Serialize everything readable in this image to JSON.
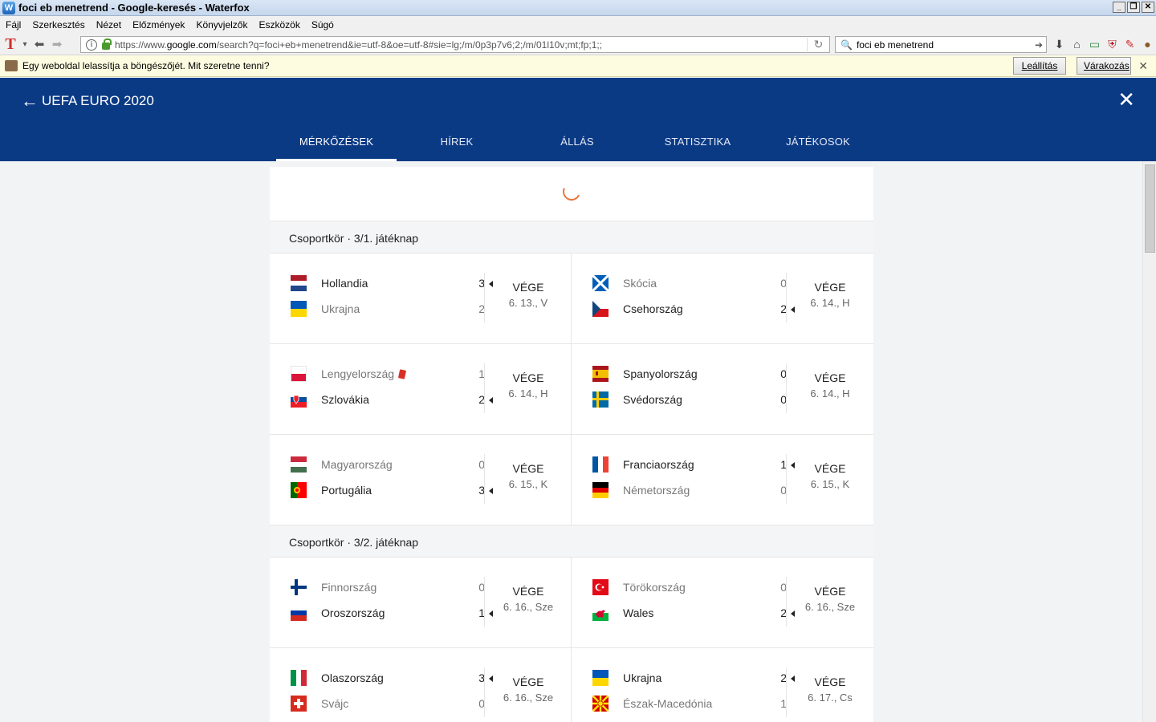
{
  "window": {
    "title": "foci eb menetrend - Google-keresés - Waterfox",
    "icon": "waterfox-icon"
  },
  "menu": [
    "Fájl",
    "Szerkesztés",
    "Nézet",
    "Előzmények",
    "Könyvjelzők",
    "Eszközök",
    "Súgó"
  ],
  "navbar": {
    "url_prefix": "https://www.",
    "url_domain": "google.com",
    "url_rest": "/search?q=foci+eb+menetrend&ie=utf-8&oe=utf-8#sie=lg;/m/0p3p7v6;2;/m/01l10v;mt;fp;1;;",
    "search_value": "foci eb menetrend"
  },
  "notification": {
    "text": "Egy weboldal lelassítja a böngészőjét. Mit szeretne tenni?",
    "stop_label": "Leállítás",
    "wait_label": "Várakozás"
  },
  "header": {
    "title": "UEFA EURO 2020",
    "tabs": [
      "MÉRKŐZÉSEK",
      "HÍREK",
      "ÁLLÁS",
      "STATISZTIKA",
      "JÁTÉKOSOK"
    ],
    "active_tab": 0
  },
  "groups": [
    {
      "title": "Csoportkör · 3/1. játéknap",
      "rows": [
        [
          {
            "teams": [
              {
                "name": "Hollandia",
                "score": "3",
                "winner": true,
                "flag": "nl"
              },
              {
                "name": "Ukrajna",
                "score": "2",
                "winner": false,
                "flag": "ua"
              }
            ],
            "status": "VÉGE",
            "date": "6. 13., V"
          },
          {
            "teams": [
              {
                "name": "Skócia",
                "score": "0",
                "winner": false,
                "flag": "sco"
              },
              {
                "name": "Csehország",
                "score": "2",
                "winner": true,
                "flag": "cz"
              }
            ],
            "status": "VÉGE",
            "date": "6. 14., H"
          }
        ],
        [
          {
            "teams": [
              {
                "name": "Lengyelország",
                "score": "1",
                "winner": false,
                "flag": "pl",
                "red_card": true
              },
              {
                "name": "Szlovákia",
                "score": "2",
                "winner": true,
                "flag": "sk"
              }
            ],
            "status": "VÉGE",
            "date": "6. 14., H"
          },
          {
            "teams": [
              {
                "name": "Spanyolország",
                "score": "0",
                "winner": null,
                "flag": "es"
              },
              {
                "name": "Svédország",
                "score": "0",
                "winner": null,
                "flag": "se"
              }
            ],
            "status": "VÉGE",
            "date": "6. 14., H"
          }
        ],
        [
          {
            "teams": [
              {
                "name": "Magyarország",
                "score": "0",
                "winner": false,
                "flag": "hu"
              },
              {
                "name": "Portugália",
                "score": "3",
                "winner": true,
                "flag": "pt"
              }
            ],
            "status": "VÉGE",
            "date": "6. 15., K"
          },
          {
            "teams": [
              {
                "name": "Franciaország",
                "score": "1",
                "winner": true,
                "flag": "fr"
              },
              {
                "name": "Németország",
                "score": "0",
                "winner": false,
                "flag": "de"
              }
            ],
            "status": "VÉGE",
            "date": "6. 15., K"
          }
        ]
      ]
    },
    {
      "title": "Csoportkör · 3/2. játéknap",
      "rows": [
        [
          {
            "teams": [
              {
                "name": "Finnország",
                "score": "0",
                "winner": false,
                "flag": "fi"
              },
              {
                "name": "Oroszország",
                "score": "1",
                "winner": true,
                "flag": "ru"
              }
            ],
            "status": "VÉGE",
            "date": "6. 16., Sze"
          },
          {
            "teams": [
              {
                "name": "Törökország",
                "score": "0",
                "winner": false,
                "flag": "tr"
              },
              {
                "name": "Wales",
                "score": "2",
                "winner": true,
                "flag": "wal"
              }
            ],
            "status": "VÉGE",
            "date": "6. 16., Sze"
          }
        ],
        [
          {
            "teams": [
              {
                "name": "Olaszország",
                "score": "3",
                "winner": true,
                "flag": "it"
              },
              {
                "name": "Svájc",
                "score": "0",
                "winner": false,
                "flag": "ch"
              }
            ],
            "status": "VÉGE",
            "date": "6. 16., Sze"
          },
          {
            "teams": [
              {
                "name": "Ukrajna",
                "score": "2",
                "winner": true,
                "flag": "ua"
              },
              {
                "name": "Észak-Macedónia",
                "score": "1",
                "winner": false,
                "flag": "mk"
              }
            ],
            "status": "VÉGE",
            "date": "6. 17., Cs"
          }
        ]
      ]
    }
  ],
  "colors": {
    "header_bg": "#0b3a85",
    "spinner": "#e8743b",
    "red_card": "#d93025"
  }
}
